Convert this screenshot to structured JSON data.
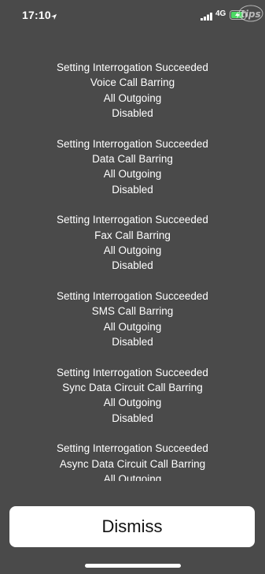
{
  "status_bar": {
    "time": "17:10",
    "network": "4G",
    "icons": [
      "location-arrow-icon",
      "signal-bars-icon",
      "charging-battery-icon"
    ],
    "watermark": "tips"
  },
  "messages": [
    {
      "status": "Setting Interrogation Succeeded",
      "service": "Voice Call Barring",
      "scope": "All Outgoing",
      "state": "Disabled"
    },
    {
      "status": "Setting Interrogation Succeeded",
      "service": "Data Call Barring",
      "scope": "All Outgoing",
      "state": "Disabled"
    },
    {
      "status": "Setting Interrogation Succeeded",
      "service": "Fax Call Barring",
      "scope": "All Outgoing",
      "state": "Disabled"
    },
    {
      "status": "Setting Interrogation Succeeded",
      "service": "SMS Call Barring",
      "scope": "All Outgoing",
      "state": "Disabled"
    },
    {
      "status": "Setting Interrogation Succeeded",
      "service": "Sync Data Circuit Call Barring",
      "scope": "All Outgoing",
      "state": "Disabled"
    },
    {
      "status": "Setting Interrogation Succeeded",
      "service": "Async Data Circuit Call Barring",
      "scope": "All Outgoing",
      "state": ""
    }
  ],
  "dismiss_label": "Dismiss",
  "colors": {
    "background": "#4a4a4a",
    "text": "#ffffff",
    "button_bg": "#ffffff",
    "button_text": "#111111"
  }
}
